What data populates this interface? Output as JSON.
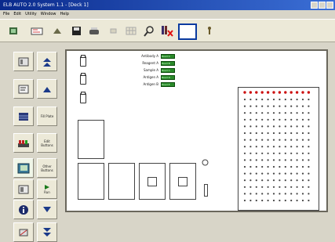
{
  "window": {
    "title": "ELB AUTO 2.0 System 1.1 - [Deck 1]"
  },
  "menu": [
    "File",
    "Edit",
    "Utility",
    "Window",
    "Help"
  ],
  "toolbar": {
    "icons": [
      "open-icon",
      "configure-icon",
      "run-icon",
      "save-icon",
      "print-icon",
      "stop-icon",
      "grid-icon",
      "zoom-icon",
      "book-delete-icon",
      "window-icon",
      "help-icon"
    ]
  },
  "side": {
    "buttons": [
      {
        "name": "deck-view-button",
        "icon": "deck-icon",
        "label": ""
      },
      {
        "name": "top-arrow-button",
        "icon": "double-up-icon",
        "label": ""
      },
      {
        "name": "edit-deck-button",
        "icon": "edit-icon",
        "label": ""
      },
      {
        "name": "up-arrow-button",
        "icon": "up-icon",
        "label": ""
      },
      {
        "name": "grid-button",
        "icon": "grid-icon",
        "label": ""
      },
      {
        "name": "fill-plate-button",
        "icon": "",
        "label": "Fill Plate"
      },
      {
        "name": "rack-button",
        "icon": "rack-icon",
        "label": ""
      },
      {
        "name": "edit-buttons-button",
        "icon": "",
        "label": "Edit Buttons"
      },
      {
        "name": "book-button",
        "icon": "book-icon",
        "label": ""
      },
      {
        "name": "other-buttons-button",
        "icon": "",
        "label": "Other Buttons"
      },
      {
        "name": "deck-2-button",
        "icon": "deck-icon",
        "label": ""
      },
      {
        "name": "run-button",
        "icon": "play-icon",
        "label": "Run"
      },
      {
        "name": "info-button",
        "icon": "info-icon",
        "label": ""
      },
      {
        "name": "down-arrow-button",
        "icon": "down-icon",
        "label": ""
      },
      {
        "name": "tools-button",
        "icon": "tools-icon",
        "label": ""
      },
      {
        "name": "bottom-arrow-button",
        "icon": "double-down-icon",
        "label": ""
      }
    ]
  },
  "reagents": [
    {
      "label": "Antibody A",
      "value": "Bead A"
    },
    {
      "label": "Reagent A",
      "value": "Bead B"
    },
    {
      "label": "Sample A",
      "value": "Bead C"
    },
    {
      "label": "Antigen A",
      "value": "Bead D"
    },
    {
      "label": "Antigen B",
      "value": "Bead E"
    }
  ],
  "plate": {
    "rows": 16,
    "cols": 12,
    "header_color": "#cc1111"
  },
  "colors": {
    "accent_green": "#2a8a2a",
    "titlebar": "#0a2a8c"
  }
}
